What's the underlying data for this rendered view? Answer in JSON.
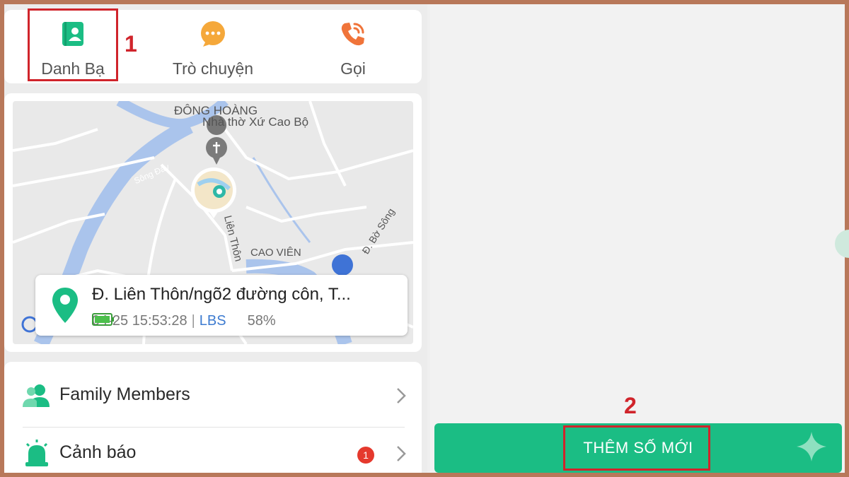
{
  "nav": {
    "contacts_label": "Danh Bạ",
    "chat_label": "Trò chuyện",
    "call_label": "Gọi"
  },
  "annotations": {
    "marker_1": "1",
    "marker_2": "2"
  },
  "map": {
    "labels": {
      "area_top": "ĐÔNG HOÀNG",
      "church": "Nhà thờ Xứ Cao Bộ",
      "river": "Sông Đáy",
      "street_vertical": "Liên Thôn",
      "area_mid": "CAO VIÊN",
      "street_right": "Đ. Bờ Sông"
    },
    "location": {
      "address": "Đ. Liên Thôn/ngõ2 đường côn, T...",
      "timestamp": "04-25 15:53:28",
      "separator": "|",
      "source": "LBS",
      "battery": "58%",
      "battery_level": 0.58
    }
  },
  "menu": {
    "items": [
      {
        "label": "Family Members",
        "icon": "family-members-icon"
      },
      {
        "label": "Cảnh báo",
        "icon": "alarm-icon",
        "badge": "1"
      }
    ]
  },
  "actions": {
    "add_number_label": "THÊM SỐ MỚI"
  },
  "colors": {
    "accent": "#1bbd84",
    "alert": "#e5392d",
    "marker": "#d0242b",
    "chat_icon": "#f5a83a",
    "call_icon": "#f0743a"
  }
}
